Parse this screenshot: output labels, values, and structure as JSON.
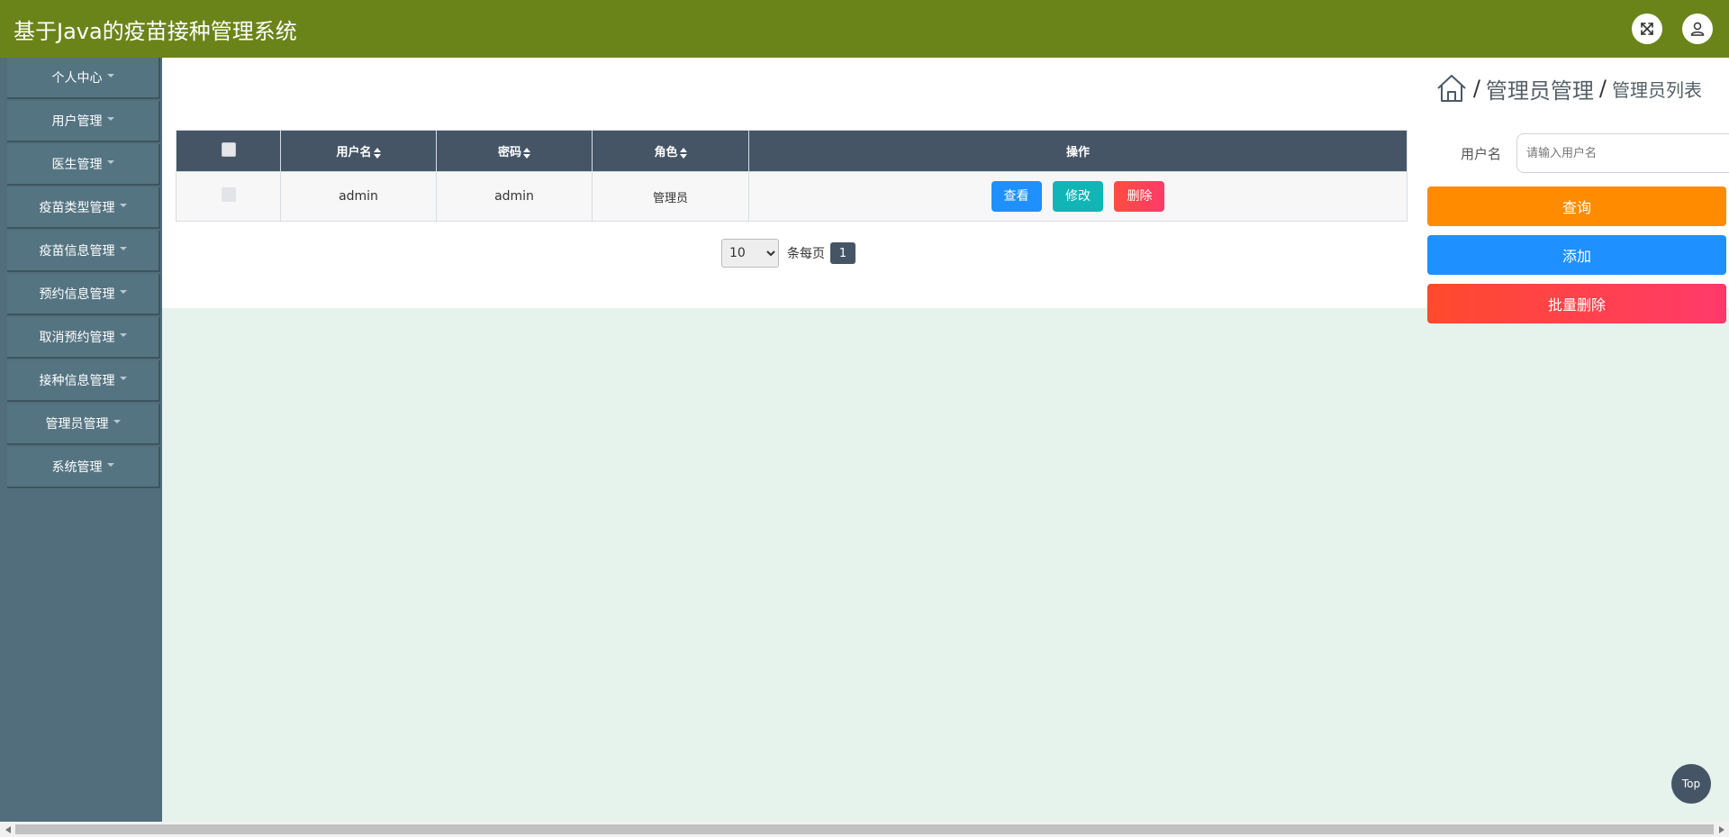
{
  "header": {
    "title": "基于Java的疫苗接种管理系统",
    "fullscreen_icon": "expand-icon",
    "user_icon": "user-icon"
  },
  "sidebar": {
    "items": [
      {
        "label": "个人中心"
      },
      {
        "label": "用户管理"
      },
      {
        "label": "医生管理"
      },
      {
        "label": "疫苗类型管理"
      },
      {
        "label": "疫苗信息管理"
      },
      {
        "label": "预约信息管理"
      },
      {
        "label": "取消预约管理"
      },
      {
        "label": "接种信息管理"
      },
      {
        "label": "管理员管理"
      },
      {
        "label": "系统管理"
      }
    ]
  },
  "breadcrumb": {
    "home_icon": "home-icon",
    "separator": "/",
    "section": "管理员管理",
    "page": "管理员列表"
  },
  "table": {
    "columns": [
      "用户名",
      "密码",
      "角色",
      "操作"
    ],
    "rows": [
      {
        "username": "admin",
        "password": "admin",
        "role": "管理员"
      }
    ],
    "actions": {
      "view": "查看",
      "edit": "修改",
      "delete": "删除"
    }
  },
  "pagination": {
    "page_size": "10",
    "page_size_options": [
      "10"
    ],
    "per_page_label": "条每页",
    "current_page": "1"
  },
  "search": {
    "label": "用户名",
    "placeholder": "请输入用户名",
    "query_button": "查询",
    "add_button": "添加",
    "batch_delete_button": "批量删除"
  },
  "top_button": "Top",
  "colors": {
    "header": "#6b8419",
    "sidebar": "#526d7b",
    "table_header": "#455566",
    "primary": "#1e90ff",
    "warning": "#ff8c00",
    "danger": "#ff4d3d",
    "teal": "#11b5b5"
  }
}
